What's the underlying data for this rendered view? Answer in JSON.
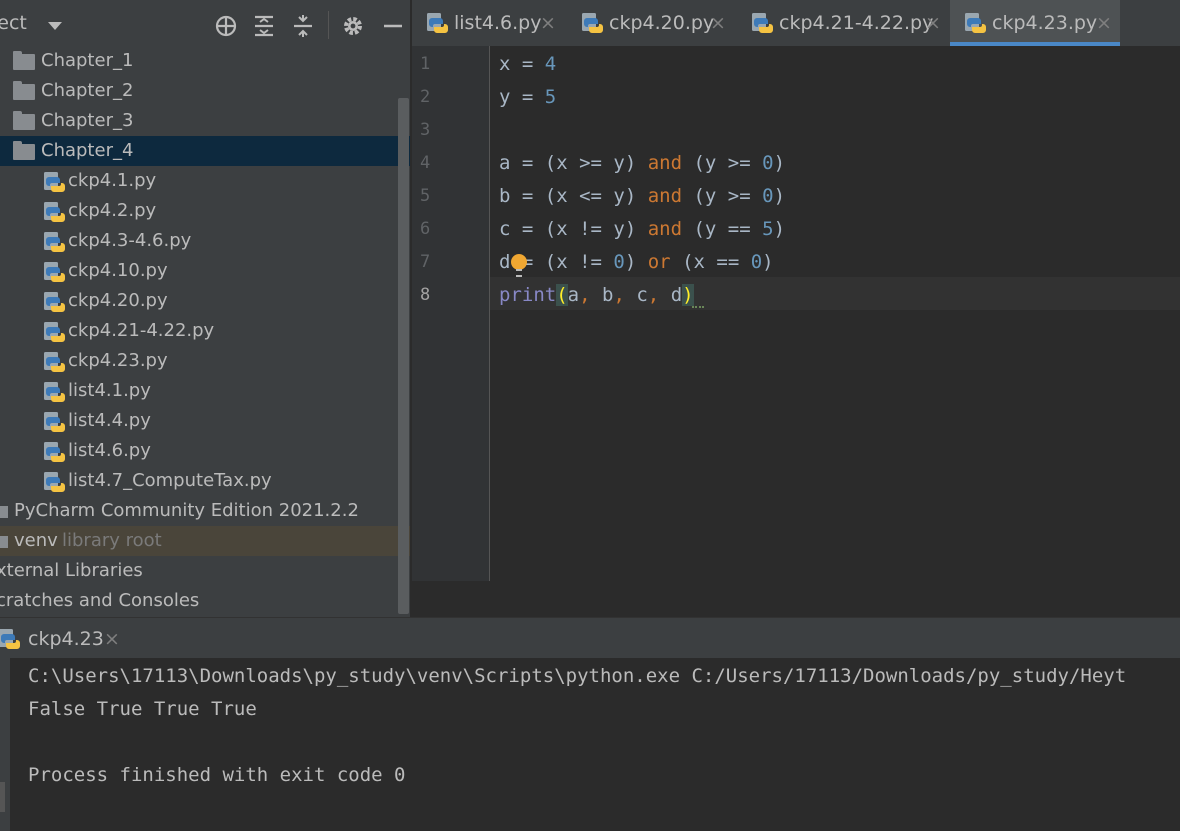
{
  "project_panel": {
    "title": "ject",
    "toolbar_icons": [
      "locate-icon",
      "expand-all-icon",
      "collapse-all-icon",
      "gear-icon",
      "hide-icon"
    ],
    "tree": [
      {
        "type": "folder",
        "label": "Chapter_1"
      },
      {
        "type": "folder",
        "label": "Chapter_2"
      },
      {
        "type": "folder",
        "label": "Chapter_3"
      },
      {
        "type": "folder",
        "label": "Chapter_4",
        "selected": true
      },
      {
        "type": "file",
        "label": "ckp4.1.py"
      },
      {
        "type": "file",
        "label": "ckp4.2.py"
      },
      {
        "type": "file",
        "label": "ckp4.3-4.6.py"
      },
      {
        "type": "file",
        "label": "ckp4.10.py"
      },
      {
        "type": "file",
        "label": "ckp4.20.py"
      },
      {
        "type": "file",
        "label": "ckp4.21-4.22.py"
      },
      {
        "type": "file",
        "label": "ckp4.23.py"
      },
      {
        "type": "file",
        "label": "list4.1.py"
      },
      {
        "type": "file",
        "label": "list4.4.py"
      },
      {
        "type": "file",
        "label": "list4.6.py"
      },
      {
        "type": "file",
        "label": "list4.7_ComputeTax.py"
      },
      {
        "type": "root",
        "label": "PyCharm Community Edition 2021.2.2"
      },
      {
        "type": "root",
        "label": "venv",
        "hint": "library root"
      },
      {
        "type": "top",
        "label": "xternal Libraries"
      },
      {
        "type": "top",
        "label": "cratches and Consoles"
      }
    ]
  },
  "editor": {
    "tabs": [
      {
        "label": "list4.6.py",
        "active": false
      },
      {
        "label": "ckp4.20.py",
        "active": false
      },
      {
        "label": "ckp4.21-4.22.py",
        "active": false
      },
      {
        "label": "ckp4.23.py",
        "active": true
      }
    ],
    "close_glyph": "×",
    "line_numbers": [
      "1",
      "2",
      "3",
      "4",
      "5",
      "6",
      "7",
      "8"
    ],
    "code": {
      "l1_a": "x = ",
      "l1_b": "4",
      "l2_a": "y = ",
      "l2_b": "5",
      "l4_a": "a = (x >= y) ",
      "l4_b": "and",
      "l4_c": " (y >= ",
      "l4_d": "0",
      "l4_e": ")",
      "l5_a": "b = (x <= y) ",
      "l5_b": "and",
      "l5_c": " (y >= ",
      "l5_d": "0",
      "l5_e": ")",
      "l6_a": "c = (x != y) ",
      "l6_b": "and",
      "l6_c": " (y == ",
      "l6_d": "5",
      "l6_e": ")",
      "l7_a": "d = (x != ",
      "l7_b": "0",
      "l7_c": ") ",
      "l7_d": "or",
      "l7_e": " (x == ",
      "l7_f": "0",
      "l7_g": ")",
      "l8_fn": "print",
      "l8_open": "(",
      "l8_a": "a",
      "l8_c1": ", ",
      "l8_b": "b",
      "l8_c2": ", ",
      "l8_c": "c",
      "l8_c3": ", ",
      "l8_d": "d",
      "l8_close": ")"
    }
  },
  "run_panel": {
    "tab_label": "ckp4.23",
    "output": [
      "C:\\Users\\17113\\Downloads\\py_study\\venv\\Scripts\\python.exe C:/Users/17113/Downloads/py_study/Heyt",
      "False True True True",
      "",
      "Process finished with exit code 0"
    ]
  },
  "colors": {
    "panel_bg": "#3c3f41",
    "editor_bg": "#2b2b2b",
    "selection": "#0d293e",
    "keyword": "#cc7832",
    "number": "#6897bb",
    "builtin": "#8888c6",
    "tab_underline": "#4a88c7"
  }
}
